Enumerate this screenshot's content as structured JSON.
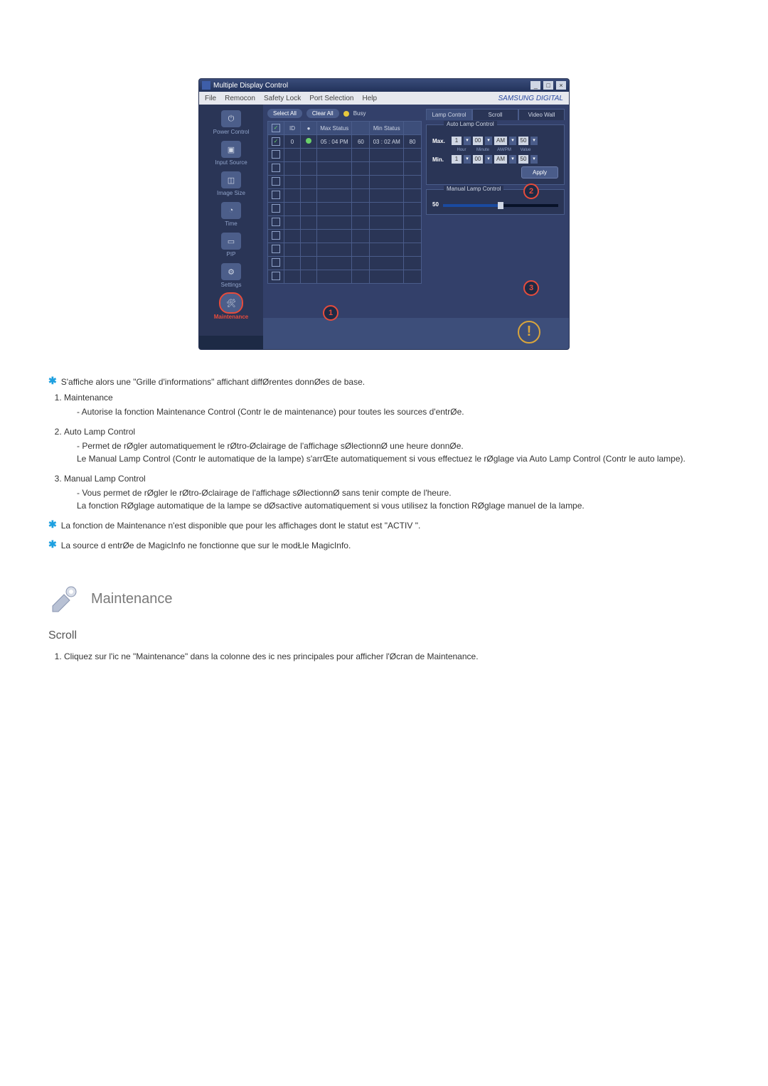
{
  "app": {
    "title": "Multiple Display Control",
    "brand": "SAMSUNG DIGITAL",
    "menus": [
      "File",
      "Remocon",
      "Safety Lock",
      "Port Selection",
      "Help"
    ],
    "window_buttons": [
      "_",
      "□",
      "×"
    ]
  },
  "sidebar": {
    "items": [
      {
        "label": "Power Control",
        "icon": "⏻"
      },
      {
        "label": "Input Source",
        "icon": "▣"
      },
      {
        "label": "Image Size",
        "icon": "◫"
      },
      {
        "label": "Time",
        "icon": "◔"
      },
      {
        "label": "PIP",
        "icon": "▭"
      },
      {
        "label": "Settings",
        "icon": "⚙"
      },
      {
        "label": "Maintenance",
        "icon": "🛠"
      }
    ],
    "active_index": 6
  },
  "toolbar": {
    "select_all": "Select All",
    "clear_all": "Clear All",
    "busy": "Busy"
  },
  "grid": {
    "headers": {
      "chk": "☑",
      "id": "ID",
      "status": "●",
      "max": "Max Status",
      "max_v": " ",
      "min": "Min Status",
      "min_v": " "
    },
    "row": {
      "id": "0",
      "max_time": "05 : 04 PM",
      "max_val": "60",
      "min_time": "03 : 02 AM",
      "min_val": "80"
    },
    "empty_rows": 10
  },
  "right": {
    "tabs": {
      "lamp": "Lamp Control",
      "scroll": "Scroll",
      "video": "Video Wall"
    },
    "active_tab": "lamp",
    "auto": {
      "legend": "Auto Lamp Control",
      "max_label": "Max.",
      "min_label": "Min.",
      "hour_label": "Hour",
      "minute_label": "Minute",
      "ampm_label": "AM/PM",
      "value_label": "Value",
      "max": {
        "hour": "1",
        "minute": "00",
        "ampm": "AM",
        "value": "50"
      },
      "min": {
        "hour": "1",
        "minute": "00",
        "ampm": "AM",
        "value": "50"
      },
      "apply": "Apply"
    },
    "manual": {
      "legend": "Manual Lamp Control",
      "value": "50"
    }
  },
  "callouts": {
    "c1": "1",
    "c2": "2",
    "c3": "3"
  },
  "doc": {
    "star1": "S'affiche alors une \"Grille d'informations\" affichant diffØrentes donnØes de base.",
    "item1_title": "Maintenance",
    "item1_sub": "Autorise la fonction Maintenance Control (Contr le de maintenance) pour toutes les sources d'entrØe.",
    "item2_title": "Auto Lamp Control",
    "item2_sub": "Permet de rØgler automatiquement le rØtro-Øclairage de l'affichage sØlectionnØ   une heure donnØe.\nLe Manual Lamp Control (Contr le automatique de la lampe) s'arrŒte automatiquement si vous effectuez le rØglage via Auto Lamp Control (Contr le auto lampe).",
    "item3_title": "Manual Lamp Control",
    "item3_sub": "Vous permet de rØgler le rØtro-Øclairage de l'affichage sØlectionnØ sans tenir compte de l'heure.\nLa fonction RØglage automatique de la lampe se dØsactive automatiquement si vous utilisez la fonction RØglage manuel de la lampe.",
    "star2": "La fonction de Maintenance n'est disponible que pour les affichages dont le statut est \"ACTIV \".",
    "star3": "La source d entrØe de MagicInfo ne fonctionne que sur le modŁle MagicInfo.",
    "section_title": "Maintenance",
    "sub_section": "Scroll",
    "scroll_item": "Cliquez sur l'ic ne \"Maintenance\" dans la colonne des ic nes principales pour afficher l'Øcran de Maintenance."
  }
}
